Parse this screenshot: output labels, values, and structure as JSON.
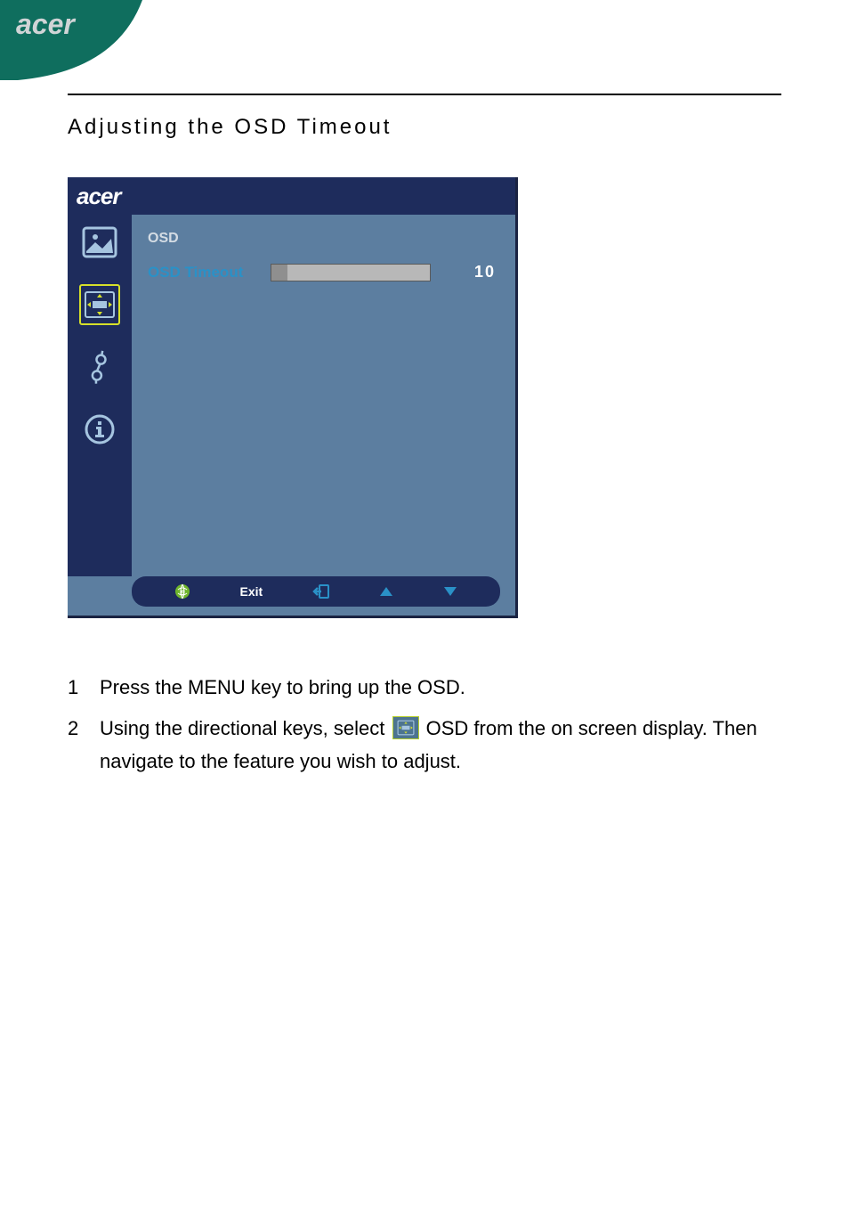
{
  "brand": "acer",
  "page_title": "Adjusting the OSD Timeout",
  "osd": {
    "brand": "acer",
    "sidebar_icons": [
      "picture-icon",
      "osd-position-icon",
      "setting-icon",
      "info-icon"
    ],
    "selected_index": 1,
    "section_title": "OSD",
    "row_label": "OSD Timeout",
    "value": "10",
    "slider_fill_percent": 10,
    "footer": {
      "e_label": "",
      "exit_label": "Exit"
    }
  },
  "instructions": [
    {
      "n": "1",
      "text": "Press the MENU key to bring up the OSD."
    },
    {
      "n": "2",
      "text_a": "Using the directional keys, select ",
      "text_b": " OSD from the on screen display. Then navigate to the feature you wish to adjust."
    }
  ]
}
